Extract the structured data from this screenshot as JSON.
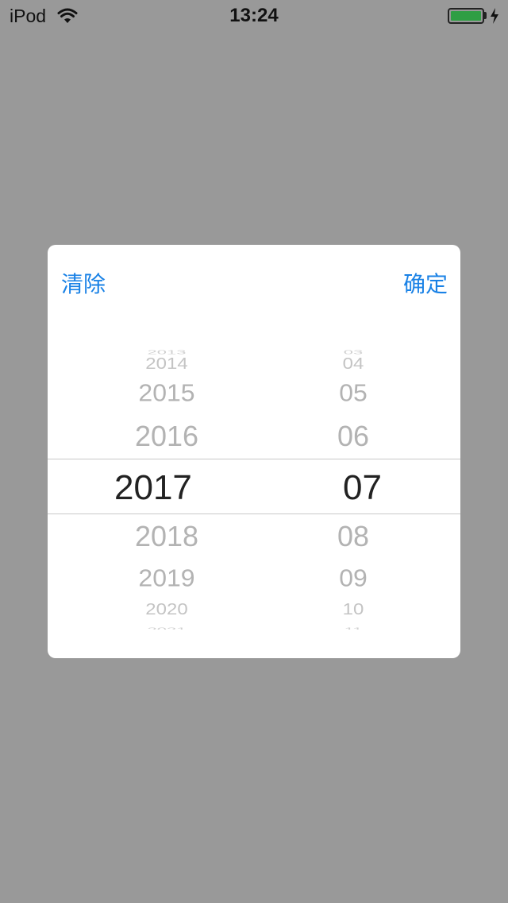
{
  "status_bar": {
    "carrier": "iPod",
    "time": "13:24",
    "battery_percent": 100,
    "charging": true
  },
  "dialog": {
    "clear_label": "清除",
    "confirm_label": "确定"
  },
  "picker": {
    "years": [
      "2013",
      "2014",
      "2015",
      "2016",
      "2017",
      "2018",
      "2019",
      "2020",
      "2021"
    ],
    "months": [
      "03",
      "04",
      "05",
      "06",
      "07",
      "08",
      "09",
      "10",
      "11"
    ],
    "selected_year": "2017",
    "selected_month": "07"
  },
  "colors": {
    "overlay": "#999999",
    "dialog_bg": "#ffffff",
    "accent": "#1a82e6",
    "selected_text": "#222222",
    "dim_text": "#b3b3b3"
  }
}
